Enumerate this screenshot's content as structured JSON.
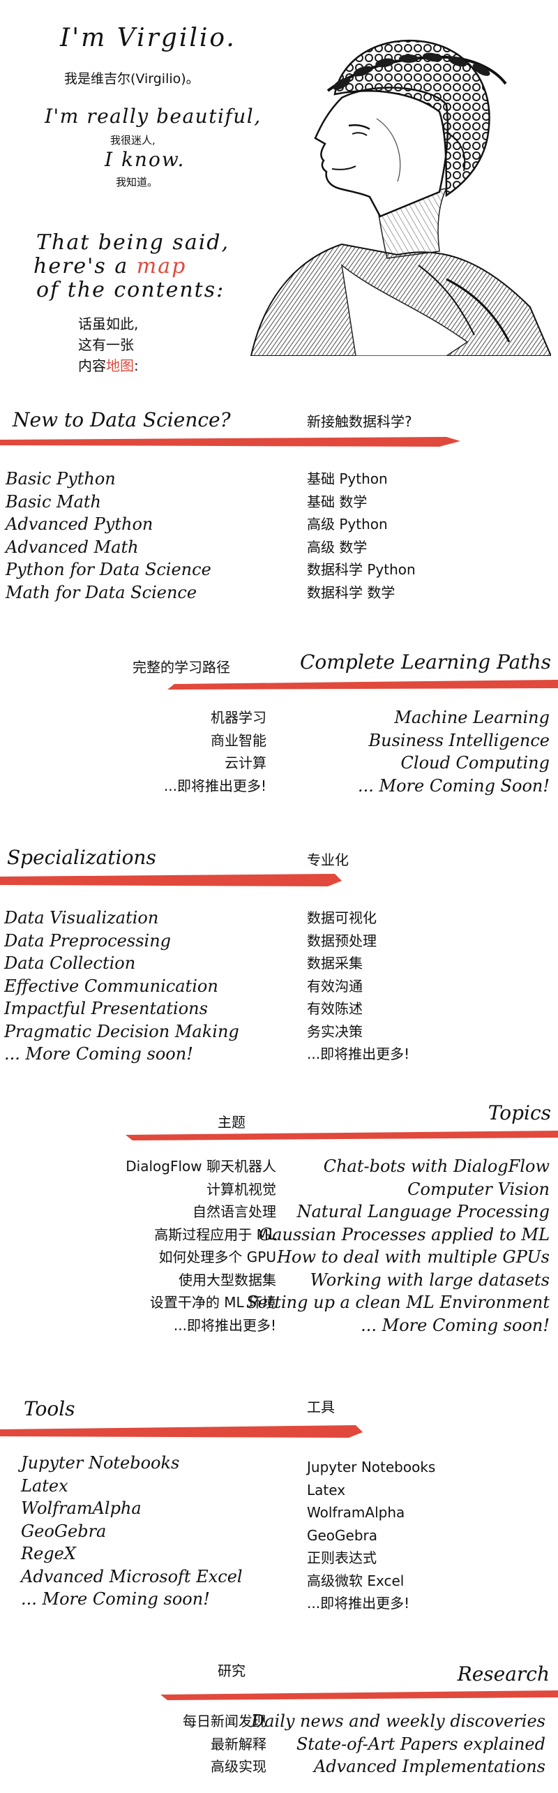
{
  "hero": {
    "title": "I'm Virgilio.",
    "title_cn": "我是维吉尔(Virgilio)。",
    "beautiful": "I'm really beautiful,",
    "beautiful_cn": "我很迷人,",
    "iknow": "I know.",
    "iknow_cn": "我知道。",
    "said_line1": "That being said,",
    "said_line2_prefix": "here's a ",
    "said_line2_highlight": "map",
    "said_line3": "of the contents:",
    "cn_line1": "话虽如此,",
    "cn_line2": "这有一张",
    "cn_line3_prefix": "内容",
    "cn_line3_highlight": "地图",
    "cn_line3_suffix": ":"
  },
  "colors": {
    "accent": "#e0493c",
    "text": "#111111",
    "background": "#ffffff"
  },
  "sections": {
    "new": {
      "title": "New to Data Science?",
      "title_cn": "新接触数据科学?",
      "items": [
        "Basic Python",
        "Basic Math",
        "Advanced Python",
        "Advanced Math",
        "Python for Data Science",
        "Math for Data Science"
      ],
      "items_cn": [
        "基础 Python",
        "基础 数学",
        "高级 Python",
        "高级 数学",
        "数据科学 Python",
        "数据科学 数学"
      ]
    },
    "paths": {
      "title": "Complete Learning Paths",
      "title_cn": "完整的学习路径",
      "items": [
        "Machine Learning",
        "Business Intelligence",
        "Cloud Computing",
        "... More Coming Soon!"
      ],
      "items_cn": [
        "机器学习",
        "商业智能",
        "云计算",
        "...即将推出更多!"
      ]
    },
    "specializations": {
      "title": "Specializations",
      "title_cn": "专业化",
      "items": [
        "Data Visualization",
        "Data Preprocessing",
        "Data Collection",
        "Effective Communication",
        "Impactful Presentations",
        "Pragmatic Decision Making",
        "... More Coming soon!"
      ],
      "items_cn": [
        "数据可视化",
        "数据预处理",
        "数据采集",
        "有效沟通",
        "有效陈述",
        "务实决策",
        "...即将推出更多!"
      ]
    },
    "topics": {
      "title": "Topics",
      "title_cn": "主题",
      "items": [
        "Chat-bots with DialogFlow",
        "Computer Vision",
        "Natural Language Processing",
        "Gaussian Processes applied to ML",
        "How to deal with multiple GPUs",
        "Working with large datasets",
        "Setting up a clean ML Environment",
        "... More Coming soon!"
      ],
      "items_cn": [
        "DialogFlow 聊天机器人",
        "计算机视觉",
        "自然语言处理",
        "高斯过程应用于 ML",
        "如何处理多个 GPU",
        "使用大型数据集",
        "设置干净的 ML 环境",
        "...即将推出更多!"
      ]
    },
    "tools": {
      "title": "Tools",
      "title_cn": "工具",
      "items": [
        "Jupyter Notebooks",
        "Latex",
        "WolframAlpha",
        "GeoGebra",
        "RegeX",
        "Advanced Microsoft Excel",
        "... More Coming soon!"
      ],
      "items_cn": [
        "Jupyter Notebooks",
        "Latex",
        "WolframAlpha",
        "GeoGebra",
        "正则表达式",
        "高级微软 Excel",
        "...即将推出更多!"
      ]
    },
    "research": {
      "title": "Research",
      "title_cn": "研究",
      "items": [
        "Daily news and weekly discoveries",
        "State-of-Art Papers explained",
        "Advanced Implementations"
      ],
      "items_cn": [
        "每日新闻发现",
        "最新解释",
        "高级实现"
      ]
    }
  }
}
